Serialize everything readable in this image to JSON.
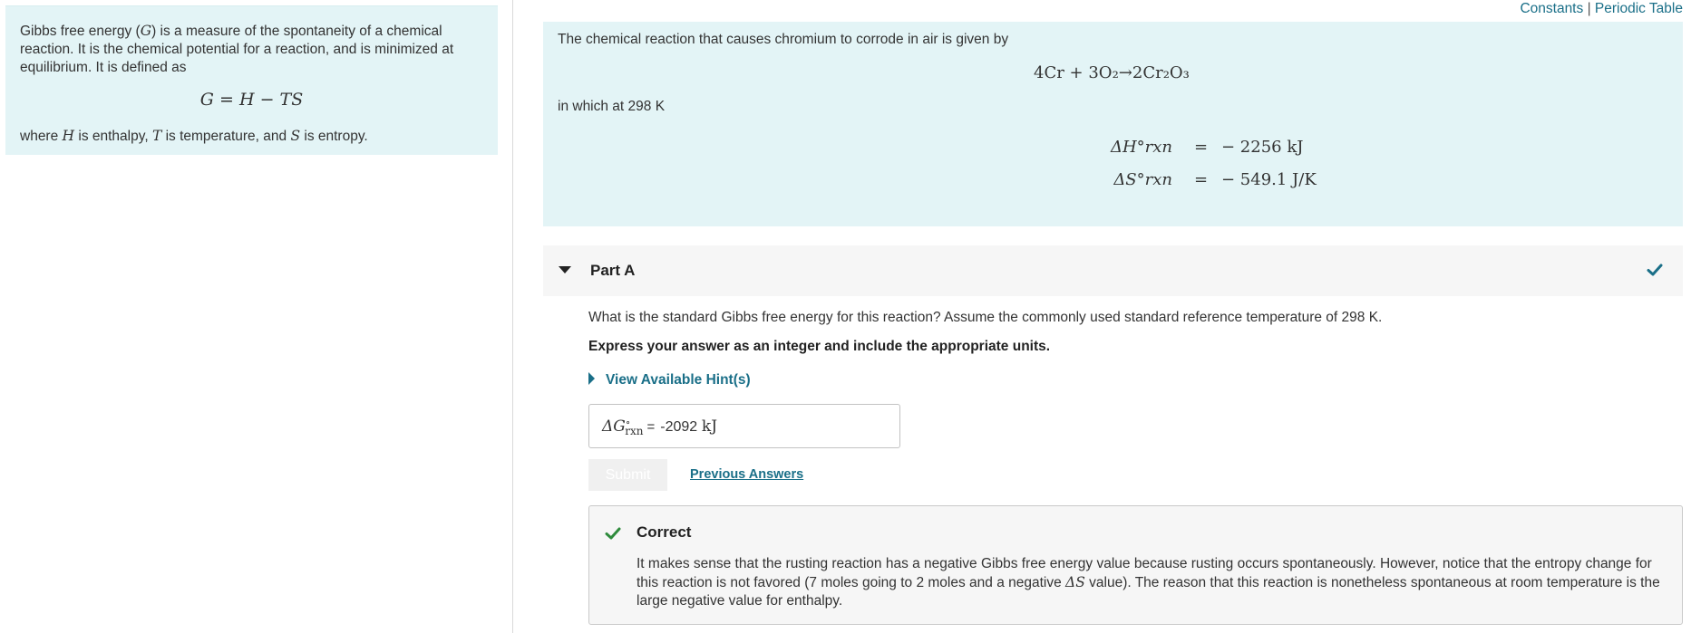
{
  "top_links": {
    "constants": "Constants",
    "separator": "|",
    "periodic_table": "Periodic Table"
  },
  "left_panel": {
    "intro_before_symbol": "Gibbs free energy (",
    "symbol_G": "G",
    "intro_after_symbol": ") is a measure of the spontaneity of a chemical reaction. It is the chemical potential for a reaction, and is minimized at equilibrium. It is defined as",
    "formula": "G = H − TS",
    "where_1": "where ",
    "sym_H": "H",
    "where_2": " is enthalpy, ",
    "sym_T": "T",
    "where_3": " is temperature, and ",
    "sym_S": "S",
    "where_4": " is entropy."
  },
  "problem": {
    "intro": "The chemical reaction that causes chromium to corrode in air is given by",
    "reaction": "4Cr + 3O₂→2Cr₂O₃",
    "conditions": "in which at 298 K",
    "dh_label": "ΔH°rxn",
    "dh_value": "− 2256 kJ",
    "ds_label": "ΔS°rxn",
    "ds_value": "− 549.1 J/K",
    "equals": "="
  },
  "part_a": {
    "title": "Part A",
    "question": "What is the standard Gibbs free energy for this reaction? Assume the commonly used standard reference temperature of 298 K.",
    "instruction": "Express your answer as an integer and include the appropriate units.",
    "hint_link": "View Available Hint(s)",
    "answer_label_main": "ΔG",
    "answer_label_sup": "∘",
    "answer_label_sub": "rxn",
    "answer_equals": "=",
    "answer_value": "-2092",
    "answer_unit": "kJ",
    "submit_label": "Submit",
    "previous_answers": "Previous Answers"
  },
  "feedback": {
    "status": "Correct",
    "text_1": "It makes sense that the rusting reaction has a negative Gibbs free energy value because rusting occurs spontaneously. However, notice that the entropy change for this reaction is not favored (7 moles going to 2 moles and a negative ",
    "text_symbol": "ΔS",
    "text_2": " value). The reason that this reaction is nonetheless spontaneous at room temperature is the large negative value for enthalpy."
  },
  "colors": {
    "panel_bg": "#e3f4f6",
    "link": "#1a6f88",
    "correct_green": "#2e8b3c",
    "check_blue": "#1a6f88"
  },
  "icons": {
    "part_toggle": "caret-down-icon",
    "part_status": "check-icon",
    "hint_toggle": "caret-right-icon",
    "feedback_status": "check-icon"
  }
}
